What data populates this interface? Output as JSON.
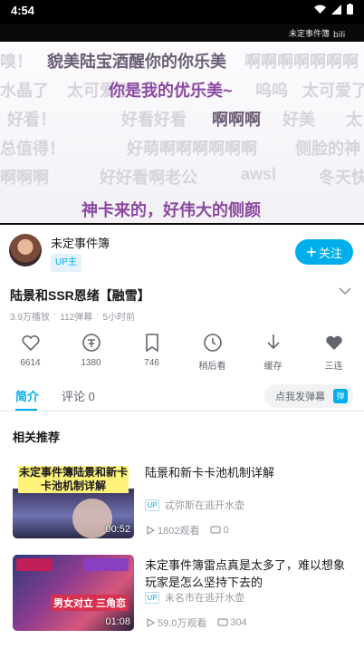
{
  "status": {
    "time": "4:54"
  },
  "video": {
    "watermark": "未定事件簿",
    "danmaku": [
      "嗅！",
      "貌美陆宝酒醒你的你乐美",
      "啊啊啊啊啊啊啊",
      "水晶了",
      "太可爱了",
      "你是我的优乐美~",
      "呜呜",
      "太可爱了",
      "好看！",
      "好看好看",
      "啊啊啊",
      "好美",
      "太",
      "总值得！",
      "好萌啊啊啊啊啊啊",
      "侧脸的神",
      "啊啊啊",
      "好好看啊老公",
      "awsl",
      "冬天快",
      "神卡来的，好伟大的侧颜"
    ]
  },
  "uploader": {
    "name": "未定事件簿",
    "tag": "UP主",
    "follow_label": "关注"
  },
  "title": "陆景和SSR恩绪【融雪】",
  "meta": {
    "views": "3.9万播放",
    "danmaku": "112弹幕",
    "time": "5小时前"
  },
  "actions": [
    {
      "label": "6614",
      "icon": "like-icon"
    },
    {
      "label": "1380",
      "icon": "coin-icon"
    },
    {
      "label": "746",
      "icon": "favorite-icon"
    },
    {
      "label": "稍后看",
      "icon": "watch-later-icon"
    },
    {
      "label": "缓存",
      "icon": "download-icon"
    },
    {
      "label": "三连",
      "icon": "triple-icon"
    }
  ],
  "tabs": {
    "intro": "简介",
    "comments": "评论 0",
    "danmaku_placeholder": "点我发弹幕",
    "danmaku_badge": "弹"
  },
  "recommend": {
    "heading": "相关推荐",
    "items": [
      {
        "title": "陆景和新卡卡池机制详解",
        "up_tag": "UP",
        "uploader": "忒弥斯在逃开水壶",
        "views": "1802观看",
        "comments": "0",
        "duration": "00:52",
        "thumb_text": "未定事件簿陆景和新卡卡池机制详解"
      },
      {
        "title": "未定事件簿雷点真是太多了，难以想象玩家是怎么坚持下去的",
        "up_tag": "UP",
        "uploader": "未名市在逃开水壶",
        "views": "59.0万观看",
        "comments": "304",
        "duration": "01:08",
        "thumb_text": "男女对立 三角恋"
      }
    ]
  }
}
